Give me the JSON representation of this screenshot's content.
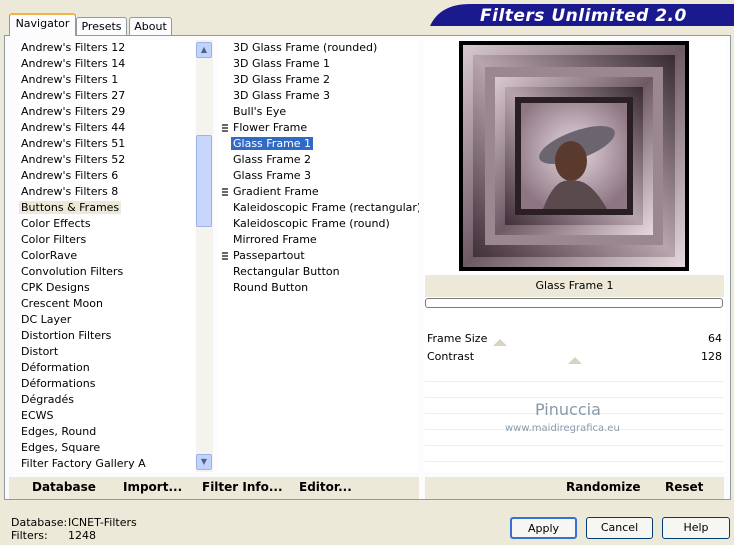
{
  "tabs": [
    {
      "label": "Navigator",
      "active": true
    },
    {
      "label": "Presets",
      "active": false
    },
    {
      "label": "About",
      "active": false
    }
  ],
  "header": {
    "title": "Filters Unlimited 2.0",
    "color": "#1a1a8e"
  },
  "categories": {
    "items": [
      "Andrew's Filters 12",
      "Andrew's Filters 14",
      "Andrew's Filters 1",
      "Andrew's Filters 27",
      "Andrew's Filters 29",
      "Andrew's Filters 44",
      "Andrew's Filters 51",
      "Andrew's Filters 52",
      "Andrew's Filters 6",
      "Andrew's Filters 8",
      "Buttons & Frames",
      "Color Effects",
      "Color Filters",
      "ColorRave",
      "Convolution Filters",
      "CPK Designs",
      "Crescent Moon",
      "DC Layer",
      "Distortion Filters",
      "Distort",
      "Déformation",
      "Déformations",
      "Dégradés",
      "ECWS",
      "Edges, Round",
      "Edges, Square",
      "Filter Factory Gallery A"
    ],
    "selected": "Buttons & Frames"
  },
  "filters": {
    "items": [
      {
        "label": "3D Glass Frame (rounded)",
        "grip": false
      },
      {
        "label": "3D Glass Frame 1",
        "grip": false
      },
      {
        "label": "3D Glass Frame 2",
        "grip": false
      },
      {
        "label": "3D Glass Frame 3",
        "grip": false
      },
      {
        "label": "Bull's Eye",
        "grip": false
      },
      {
        "label": "Flower Frame",
        "grip": true
      },
      {
        "label": "Glass Frame 1",
        "grip": false
      },
      {
        "label": "Glass Frame 2",
        "grip": false
      },
      {
        "label": "Glass Frame 3",
        "grip": false
      },
      {
        "label": "Gradient Frame",
        "grip": true
      },
      {
        "label": "Kaleidoscopic Frame (rectangular)",
        "grip": false
      },
      {
        "label": "Kaleidoscopic Frame (round)",
        "grip": false
      },
      {
        "label": "Mirrored Frame",
        "grip": false
      },
      {
        "label": "Passepartout",
        "grip": true
      },
      {
        "label": "Rectangular Button",
        "grip": false
      },
      {
        "label": "Round Button",
        "grip": false
      }
    ],
    "selected": "Glass Frame 1"
  },
  "preview": {
    "filter_name": "Glass Frame 1",
    "icon": "portrait-preview"
  },
  "params": [
    {
      "label": "Frame Size",
      "value": "64",
      "fraction": 0.25
    },
    {
      "label": "Contrast",
      "value": "128",
      "fraction": 0.5
    }
  ],
  "watermark": {
    "line1": "Pinuccia",
    "line2": "www.maidiregrafica.eu"
  },
  "left_buttons": {
    "database": "Database",
    "import": "Import...",
    "filter_info": "Filter Info...",
    "editor": "Editor..."
  },
  "right_buttons": {
    "randomize": "Randomize",
    "reset": "Reset"
  },
  "status": {
    "database_label": "Database:",
    "database_value": "ICNET-Filters",
    "filters_label": "Filters:",
    "filters_value": "1248"
  },
  "dialog_buttons": {
    "apply": "Apply",
    "cancel": "Cancel",
    "help": "Help"
  }
}
